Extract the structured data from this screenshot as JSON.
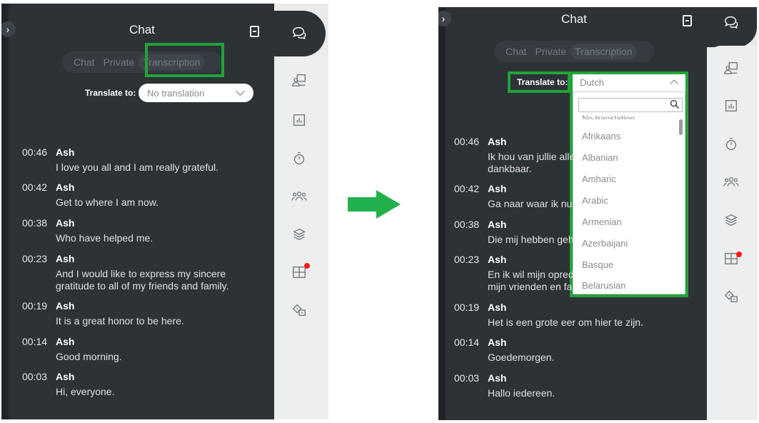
{
  "header": {
    "title": "Chat"
  },
  "tabs": [
    "Chat",
    "Private",
    "Transcription"
  ],
  "translate_label": "Translate to:",
  "left": {
    "select_value": "No translation",
    "messages": [
      {
        "time": "00:46",
        "name": "Ash",
        "text1": "I love you all and I am really grateful.",
        "text2": ""
      },
      {
        "time": "00:42",
        "name": "Ash",
        "text1": "Get to where I am now.",
        "text2": ""
      },
      {
        "time": "00:38",
        "name": "Ash",
        "text1": "Who have helped me.",
        "text2": ""
      },
      {
        "time": "00:23",
        "name": "Ash",
        "text1": "And I would like to express my sincere",
        "text2": "gratitude to all of my friends and family."
      },
      {
        "time": "00:19",
        "name": "Ash",
        "text1": "It is a great honor to be here.",
        "text2": ""
      },
      {
        "time": "00:14",
        "name": "Ash",
        "text1": "Good morning.",
        "text2": ""
      },
      {
        "time": "00:03",
        "name": "Ash",
        "text1": "Hi, everyone.",
        "text2": ""
      }
    ]
  },
  "right": {
    "select_value": "Dutch",
    "dropdown_options": [
      "No translation",
      "Afrikaans",
      "Albanian",
      "Amharic",
      "Arabic",
      "Armenian",
      "Azerbaijani",
      "Basque",
      "Belarusian"
    ],
    "messages": [
      {
        "time": "00:46",
        "name": "Ash",
        "text1": "Ik hou van jullie alle",
        "text2": "dankbaar."
      },
      {
        "time": "00:42",
        "name": "Ash",
        "text1": "Ga naar waar ik nu",
        "text2": ""
      },
      {
        "time": "00:38",
        "name": "Ash",
        "text1": "Die mij hebben geh",
        "text2": ""
      },
      {
        "time": "00:23",
        "name": "Ash",
        "text1": "En ik wil mijn opred",
        "text2": "mijn vrienden en fa"
      },
      {
        "time": "00:19",
        "name": "Ash",
        "text1": "Het is een grote eer om hier te zijn.",
        "text2": ""
      },
      {
        "time": "00:14",
        "name": "Ash",
        "text1": "Goedemorgen.",
        "text2": ""
      },
      {
        "time": "00:03",
        "name": "Ash",
        "text1": "Hallo iedereen.",
        "text2": ""
      }
    ]
  },
  "icons": [
    "chat-bubbles-icon",
    "presenter-icon",
    "poll-chart-icon",
    "timer-icon",
    "group-icon",
    "layers-icon",
    "grid-icon",
    "dice-icon",
    "document-icon",
    "chevron-right-icon",
    "arrow-right-icon",
    "search-icon"
  ],
  "colors": {
    "dark_bg": "#2d3237",
    "rail_bg": "#eceeef",
    "highlight_green": "#21a33a",
    "notification_red": "#ff1a1a",
    "arrow_green": "#22b14c"
  }
}
